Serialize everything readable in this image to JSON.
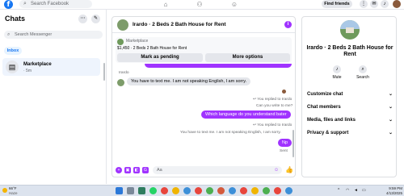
{
  "topbar": {
    "logo": "f",
    "search_placeholder": "Search Facebook",
    "find_friends": "Find friends",
    "nav_icons": [
      "home-icon",
      "friends-icon",
      "groups-icon"
    ],
    "right_icons": [
      "menu-icon",
      "messenger-icon",
      "notifications-icon"
    ]
  },
  "left": {
    "title": "Chats",
    "more": "⋯",
    "compose": "✎",
    "search_placeholder": "Search Messenger",
    "inbox_label": "Inbox",
    "conversation": {
      "name": "Marketplace",
      "sub": "· 5m"
    }
  },
  "chat": {
    "title": "Irardo · 2 Beds 2 Bath House for Rent",
    "info": "i",
    "listing": {
      "category": "Marketplace",
      "price_line": "$1,450 · 2 Beds 2 Bath House for Rent",
      "mark_pending": "Mark as pending",
      "more_options": "More options"
    },
    "messages": {
      "sender_name": "Irardo",
      "msg1": "You have to text me. I am not speaking English, I am sorry.",
      "reply1": "↩ You replied to Irardo",
      "quote1": "Can you write to me?",
      "out1": "Which language do you understand bater",
      "reply2": "↩ You replied to Irardo",
      "quote2": "You have to text me. I am not speaking English, I am sorry.",
      "out2": "Np",
      "sent": "Sent"
    },
    "composer": {
      "placeholder": "Aa"
    }
  },
  "right": {
    "title": "Irardo · 2 Beds 2 Bath House for Rent",
    "mute_label": "Mute",
    "search_label": "Search",
    "rows": [
      "Customize chat",
      "Chat members",
      "Media, files and links",
      "Privacy & support"
    ]
  },
  "taskbar": {
    "temp": "66°F",
    "condition": "Haze",
    "time": "9:59 PM",
    "date": "4/13/2025"
  },
  "colors": {
    "accent": "#a033ff",
    "facebook_blue": "#1877f2",
    "bubble_gray": "#e4e6eb"
  }
}
